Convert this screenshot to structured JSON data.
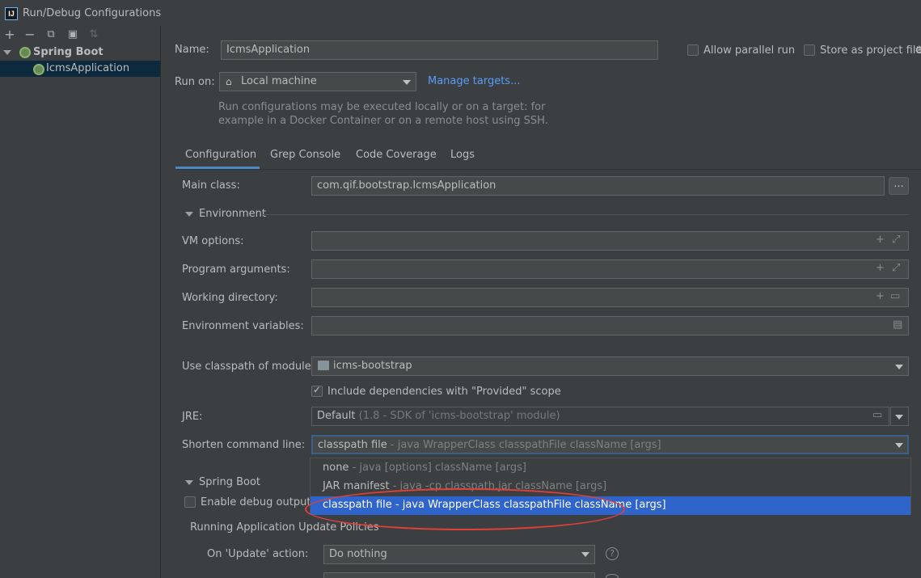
{
  "window": {
    "title": "Run/Debug Configurations",
    "app_icon_text": "IJ"
  },
  "toolbar": {
    "add": "+",
    "remove": "−",
    "copy": "⧉",
    "folder": "▣",
    "sort": "⇅"
  },
  "tree": {
    "group_label": "Spring Boot",
    "item_label": "IcmsApplication"
  },
  "header": {
    "name_label": "Name:",
    "name_value": "IcmsApplication",
    "allow_parallel_label": "Allow parallel run",
    "store_project_label": "Store as project file",
    "run_on_label": "Run on:",
    "run_on_value": "Local machine",
    "manage_targets": "Manage targets...",
    "help_line1": "Run configurations may be executed locally or on a target: for",
    "help_line2": "example in a Docker Container or on a remote host using SSH."
  },
  "tabs": [
    "Configuration",
    "Grep Console",
    "Code Coverage",
    "Logs"
  ],
  "config": {
    "main_class_label": "Main class:",
    "main_class_value": "com.qif.bootstrap.IcmsApplication",
    "dots": "...",
    "environment_label": "Environment",
    "vm_options_label": "VM options:",
    "program_args_label": "Program arguments:",
    "working_dir_label": "Working directory:",
    "env_vars_label": "Environment variables:",
    "classpath_label": "Use classpath of module:",
    "classpath_value": "icms-bootstrap",
    "include_deps_label": "Include dependencies with \"Provided\" scope",
    "jre_label": "JRE:",
    "jre_value": "Default",
    "jre_hint": "(1.8 - SDK of 'icms-bootstrap' module)",
    "shorten_label": "Shorten command line:",
    "shorten_value": "classpath file",
    "shorten_hint": "- java WrapperClass classpathFile className [args]",
    "spring_boot_label": "Spring Boot",
    "enable_debug_label": "Enable debug output",
    "running_policies_label": "Running Application Update Policies",
    "on_update_label": "On 'Update' action:",
    "on_update_value": "Do nothing"
  },
  "popup": [
    {
      "name": "none",
      "hint": "- java [options] className [args]"
    },
    {
      "name": "JAR manifest",
      "hint": "- java -cp classpath.jar className [args]"
    },
    {
      "name": "classpath file",
      "hint": "- java WrapperClass classpathFile className [args]"
    }
  ],
  "colors": {
    "selection": "#2f65ca",
    "annotation": "#e0403a",
    "link": "#589df6"
  }
}
